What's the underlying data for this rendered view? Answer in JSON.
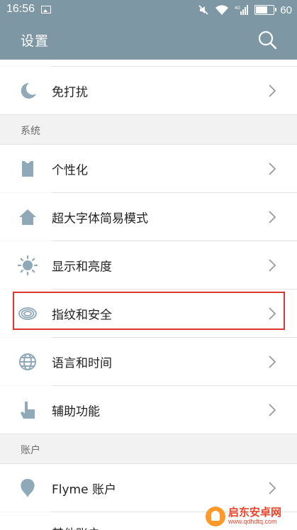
{
  "status_bar": {
    "time": "16:56",
    "signal_label": "4G",
    "battery_level": "60"
  },
  "app_bar": {
    "title": "设置"
  },
  "items": {
    "dnd": "免打扰",
    "personalize": "个性化",
    "large_font": "超大字体简易模式",
    "display": "显示和亮度",
    "fingerprint": "指纹和安全",
    "language": "语言和时间",
    "accessibility": "辅助功能",
    "flyme_account": "Flyme 账户",
    "other_account": "其他账户"
  },
  "sections": {
    "system": "系统",
    "account": "账户"
  },
  "watermark": {
    "name": "启东安卓网",
    "url": "www.qdhdtq.com"
  },
  "colors": {
    "accent": "#7d97a5",
    "highlight": "#d9372f",
    "icon": "#8fa9b8"
  }
}
